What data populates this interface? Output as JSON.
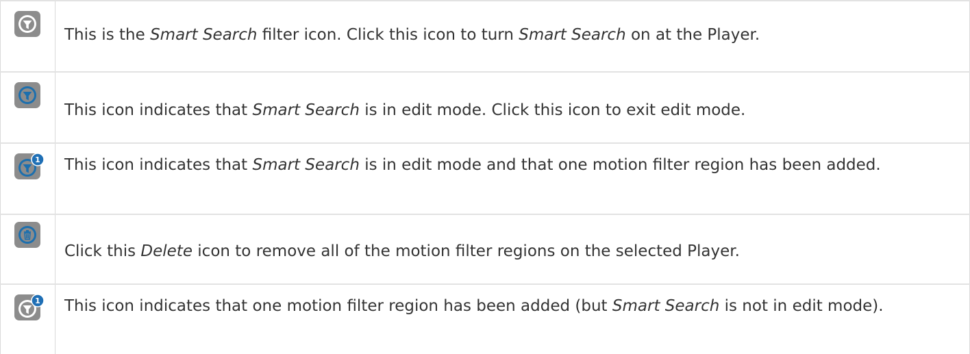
{
  "rows": [
    {
      "icon": "smart-search-filter-icon",
      "parts": [
        "This is the ",
        "Smart Search",
        " filter icon. Click this icon to turn ",
        "Smart Search",
        " on at the Player."
      ]
    },
    {
      "icon": "smart-search-edit-mode-icon",
      "parts": [
        "This icon indicates that ",
        "Smart Search",
        " is in edit mode. Click this icon to exit edit mode."
      ]
    },
    {
      "icon": "smart-search-edit-mode-one-region-icon",
      "badge": "1",
      "parts": [
        "This icon indicates that ",
        "Smart Search",
        " is in edit mode and that one motion filter region has been added."
      ]
    },
    {
      "icon": "delete-trash-icon",
      "parts": [
        "Click this ",
        "Delete",
        " icon to remove all of the motion filter regions on the selected Player."
      ]
    },
    {
      "icon": "smart-search-one-region-icon",
      "badge": "1",
      "parts": [
        "This icon indicates that one motion filter region has been added (but ",
        "Smart Search",
        " is not in edit mode)."
      ]
    }
  ],
  "colors": {
    "icon_gray": "#8c8c8c",
    "icon_blue": "#1c6fae",
    "badge_blue": "#1f6fb5",
    "border": "#d9d9d9",
    "text": "#333333"
  }
}
